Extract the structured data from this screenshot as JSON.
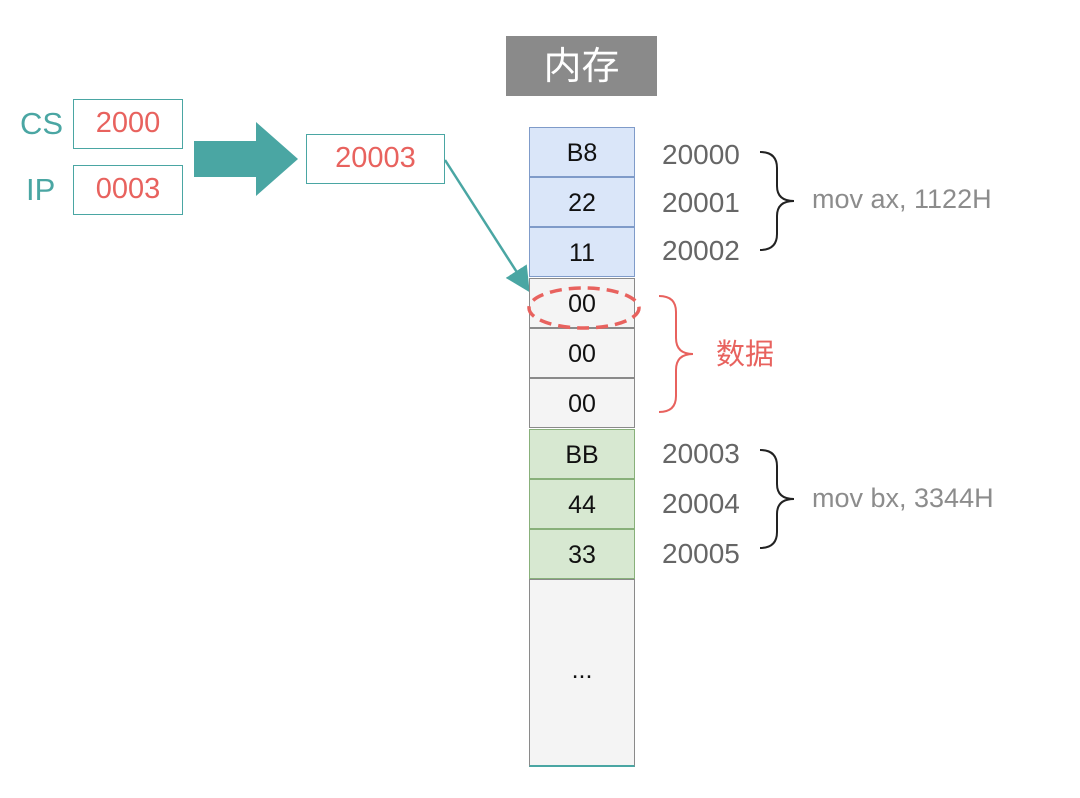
{
  "memory": {
    "title": "内存",
    "cells": [
      "B8",
      "22",
      "11",
      "00",
      "00",
      "00",
      "BB",
      "44",
      "33",
      "..."
    ]
  },
  "registers": {
    "cs": {
      "label": "CS",
      "value": "2000"
    },
    "ip": {
      "label": "IP",
      "value": "0003"
    }
  },
  "computed_address": "20003",
  "addresses": [
    "20000",
    "20001",
    "20002",
    "20003",
    "20004",
    "20005"
  ],
  "groups": {
    "instruction_1": "mov ax, 1122H",
    "data": "数据",
    "instruction_2": "mov bx, 3344H"
  },
  "colors": {
    "teal": "#4aa6a3",
    "red": "#e8625e",
    "title_bg": "#8a8a8a",
    "code_bg": "#dae6f9",
    "code2_bg": "#d7e8d1",
    "data_bg": "#f4f4f4"
  }
}
